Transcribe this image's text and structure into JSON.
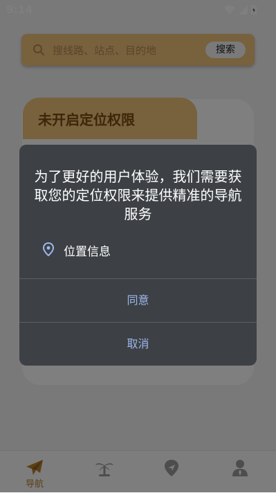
{
  "status_bar": {
    "time": "9:14",
    "icons": [
      "wifi-icon",
      "signal-icon",
      "battery-icon"
    ]
  },
  "search": {
    "placeholder": "搜线路、站点、目的地",
    "button_label": "搜索",
    "icon": "search-icon"
  },
  "card": {
    "title": "未开启定位权限"
  },
  "tabbar": {
    "items": [
      {
        "label": "导航",
        "icon": "paper-plane-icon",
        "active": true
      },
      {
        "label": "",
        "icon": "palm-tree-icon",
        "active": false
      },
      {
        "label": "",
        "icon": "location-route-icon",
        "active": false
      },
      {
        "label": "",
        "icon": "person-icon",
        "active": false
      }
    ]
  },
  "dialog": {
    "message": "为了更好的用户体验，我们需要获取您的定位权限来提供精准的导航服务",
    "permission_label": "位置信息",
    "permission_icon": "location-pin-icon",
    "agree_label": "同意",
    "cancel_label": "取消"
  },
  "colors": {
    "accent": "#f0c27a",
    "dialog_bg": "#3d4145",
    "dialog_button": "#9db8ee",
    "tab_active": "#b9812a"
  }
}
